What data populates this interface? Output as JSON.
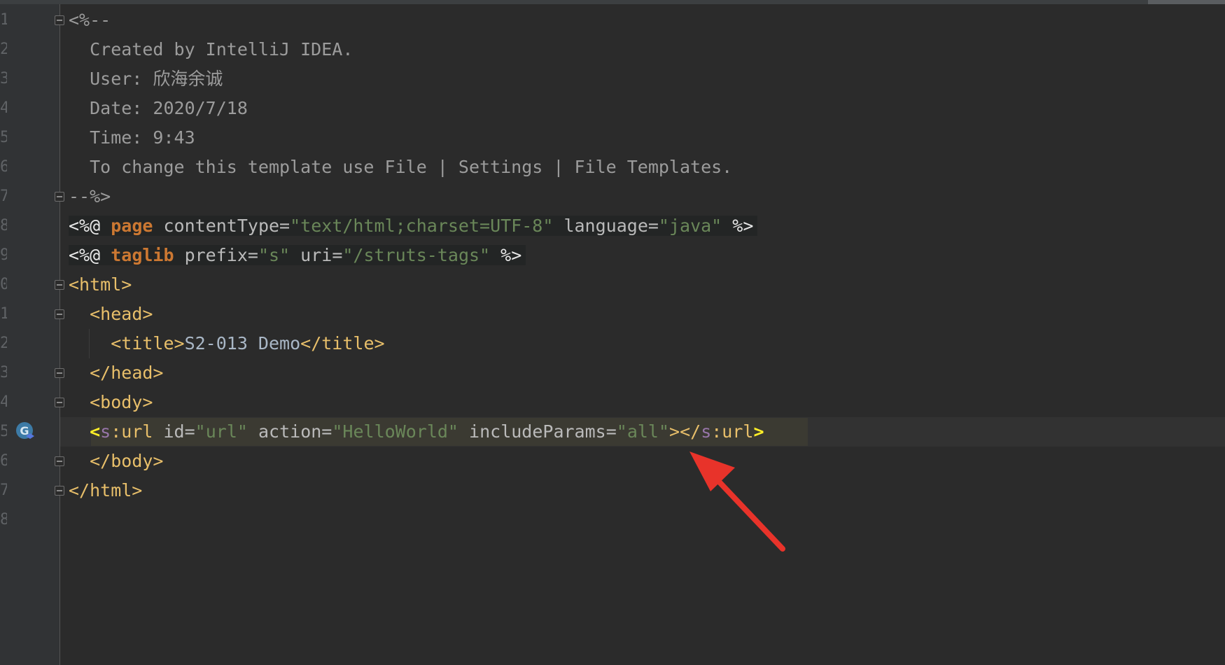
{
  "editor": {
    "line_numbers": [
      "1",
      "2",
      "3",
      "4",
      "5",
      "6",
      "7",
      "8",
      "9",
      "0",
      "1",
      "2",
      "3",
      "4",
      "5",
      "6",
      "7",
      "8"
    ],
    "lines": [
      {
        "parts": [
          {
            "t": "<%--",
            "c": "c-comment"
          }
        ]
      },
      {
        "parts": [
          {
            "t": "  Created by IntelliJ IDEA.",
            "c": "c-comment"
          }
        ]
      },
      {
        "parts": [
          {
            "t": "  User: 欣海余诚",
            "c": "c-comment"
          }
        ]
      },
      {
        "parts": [
          {
            "t": "  Date: 2020/7/18",
            "c": "c-comment"
          }
        ]
      },
      {
        "parts": [
          {
            "t": "  Time: 9:43",
            "c": "c-comment"
          }
        ]
      },
      {
        "parts": [
          {
            "t": "  To change this template use File | Settings | File Templates.",
            "c": "c-comment"
          }
        ]
      },
      {
        "parts": [
          {
            "t": "--%>",
            "c": "c-comment"
          }
        ]
      },
      {
        "bg": "directive",
        "parts": [
          {
            "t": "<%@ ",
            "c": "c-delim"
          },
          {
            "t": "page",
            "c": "c-kw"
          },
          {
            "t": " contentType=",
            "c": "c-attr"
          },
          {
            "t": "\"text/html;charset=UTF-8\"",
            "c": "c-str"
          },
          {
            "t": " language=",
            "c": "c-attr"
          },
          {
            "t": "\"java\"",
            "c": "c-str"
          },
          {
            "t": " %>",
            "c": "c-delim"
          }
        ]
      },
      {
        "bg": "directive",
        "parts": [
          {
            "t": "<%@ ",
            "c": "c-delim"
          },
          {
            "t": "taglib",
            "c": "c-kw"
          },
          {
            "t": " prefix=",
            "c": "c-attr"
          },
          {
            "t": "\"s\"",
            "c": "c-str"
          },
          {
            "t": " uri=",
            "c": "c-attr"
          },
          {
            "t": "\"/struts-tags\"",
            "c": "c-str"
          },
          {
            "t": " %>",
            "c": "c-delim"
          }
        ]
      },
      {
        "parts": [
          {
            "t": "<html>",
            "c": "c-tag"
          }
        ]
      },
      {
        "parts": [
          {
            "t": "  ",
            "c": "c-text"
          },
          {
            "t": "<head>",
            "c": "c-tag"
          }
        ]
      },
      {
        "parts": [
          {
            "t": "    ",
            "c": "c-text"
          },
          {
            "t": "<title>",
            "c": "c-tag"
          },
          {
            "t": "S2-013 Demo",
            "c": "c-text"
          },
          {
            "t": "</title>",
            "c": "c-tag"
          }
        ]
      },
      {
        "parts": [
          {
            "t": "  ",
            "c": "c-text"
          },
          {
            "t": "</head>",
            "c": "c-tag"
          }
        ]
      },
      {
        "parts": [
          {
            "t": "  ",
            "c": "c-text"
          },
          {
            "t": "<body>",
            "c": "c-tag"
          }
        ]
      },
      {
        "parts": [
          {
            "t": "  ",
            "c": "c-text"
          },
          {
            "t": "<",
            "c": "c-bracket-hl"
          },
          {
            "t": "s",
            "c": "c-ns"
          },
          {
            "t": ":url",
            "c": "c-tag"
          },
          {
            "t": " id=",
            "c": "c-attr"
          },
          {
            "t": "\"url\"",
            "c": "c-str"
          },
          {
            "t": " action=",
            "c": "c-attr"
          },
          {
            "t": "\"HelloWorld\"",
            "c": "c-str"
          },
          {
            "t": " includeParams=",
            "c": "c-attr"
          },
          {
            "t": "\"all\"",
            "c": "c-str"
          },
          {
            "t": "></",
            "c": "c-tag"
          },
          {
            "t": "s",
            "c": "c-ns"
          },
          {
            "t": ":url",
            "c": "c-tag"
          },
          {
            "t": ">",
            "c": "c-bracket-hl"
          }
        ]
      },
      {
        "parts": [
          {
            "t": "  ",
            "c": "c-text"
          },
          {
            "t": "</body>",
            "c": "c-tag"
          }
        ]
      },
      {
        "parts": [
          {
            "t": "</html>",
            "c": "c-tag"
          }
        ]
      },
      {
        "parts": []
      }
    ],
    "fold_lines": [
      1,
      7,
      10,
      11,
      13,
      14,
      16,
      17
    ],
    "annotation_color": "#e8332a",
    "gutter_icon": "struts-tag-icon"
  }
}
